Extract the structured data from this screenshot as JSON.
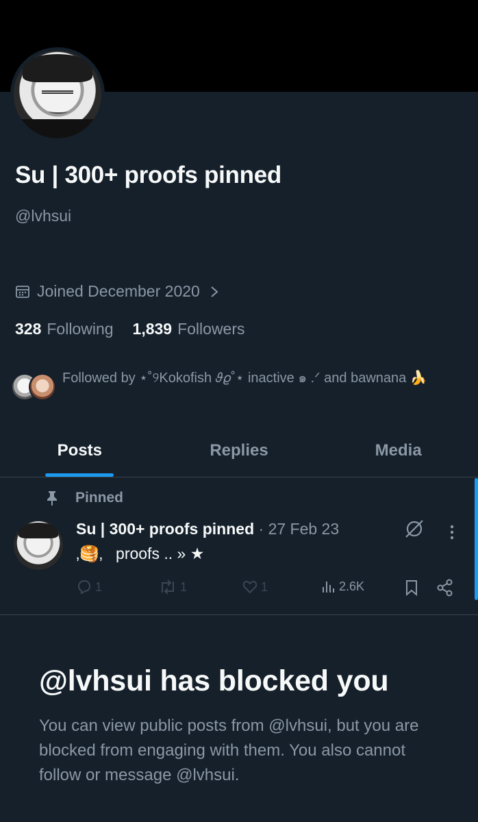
{
  "profile": {
    "name": "Su | 300+ proofs pinned",
    "handle": "@lvhsui",
    "joined": "Joined December 2020",
    "following_count": "328",
    "following_label": "Following",
    "followers_count": "1,839",
    "followers_label": "Followers",
    "followed_by": "Followed by ⋆˚୨Kokofish 𝜗𝜚˚⋆ inactive ๑ .ᐟ and bawnana 🍌"
  },
  "tabs": [
    {
      "label": "Posts",
      "active": true
    },
    {
      "label": "Replies",
      "active": false
    },
    {
      "label": "Media",
      "active": false
    }
  ],
  "pinned_post": {
    "pinned_label": "Pinned",
    "author": "Su | 300+ proofs pinned",
    "date": "· 27 Feb 23",
    "text": "‚🥞‚   proofs .. » ★",
    "replies": "1",
    "reposts": "1",
    "likes": "1",
    "views": "2.6K"
  },
  "blocked": {
    "title": "@lvhsui has blocked you",
    "message": "You can view public posts from @lvhsui, but you are blocked from engaging with them. You also cannot follow or message @lvhsui."
  },
  "colors": {
    "background": "#15202b",
    "accent": "#1d9bf0",
    "secondary_text": "#8b98a5",
    "border": "#38444d"
  },
  "icons": [
    "calendar-icon",
    "chevron-right-icon",
    "pin-icon",
    "grok-icon",
    "more-icon",
    "reply-icon",
    "repost-icon",
    "like-icon",
    "views-icon",
    "bookmark-icon",
    "share-icon"
  ]
}
